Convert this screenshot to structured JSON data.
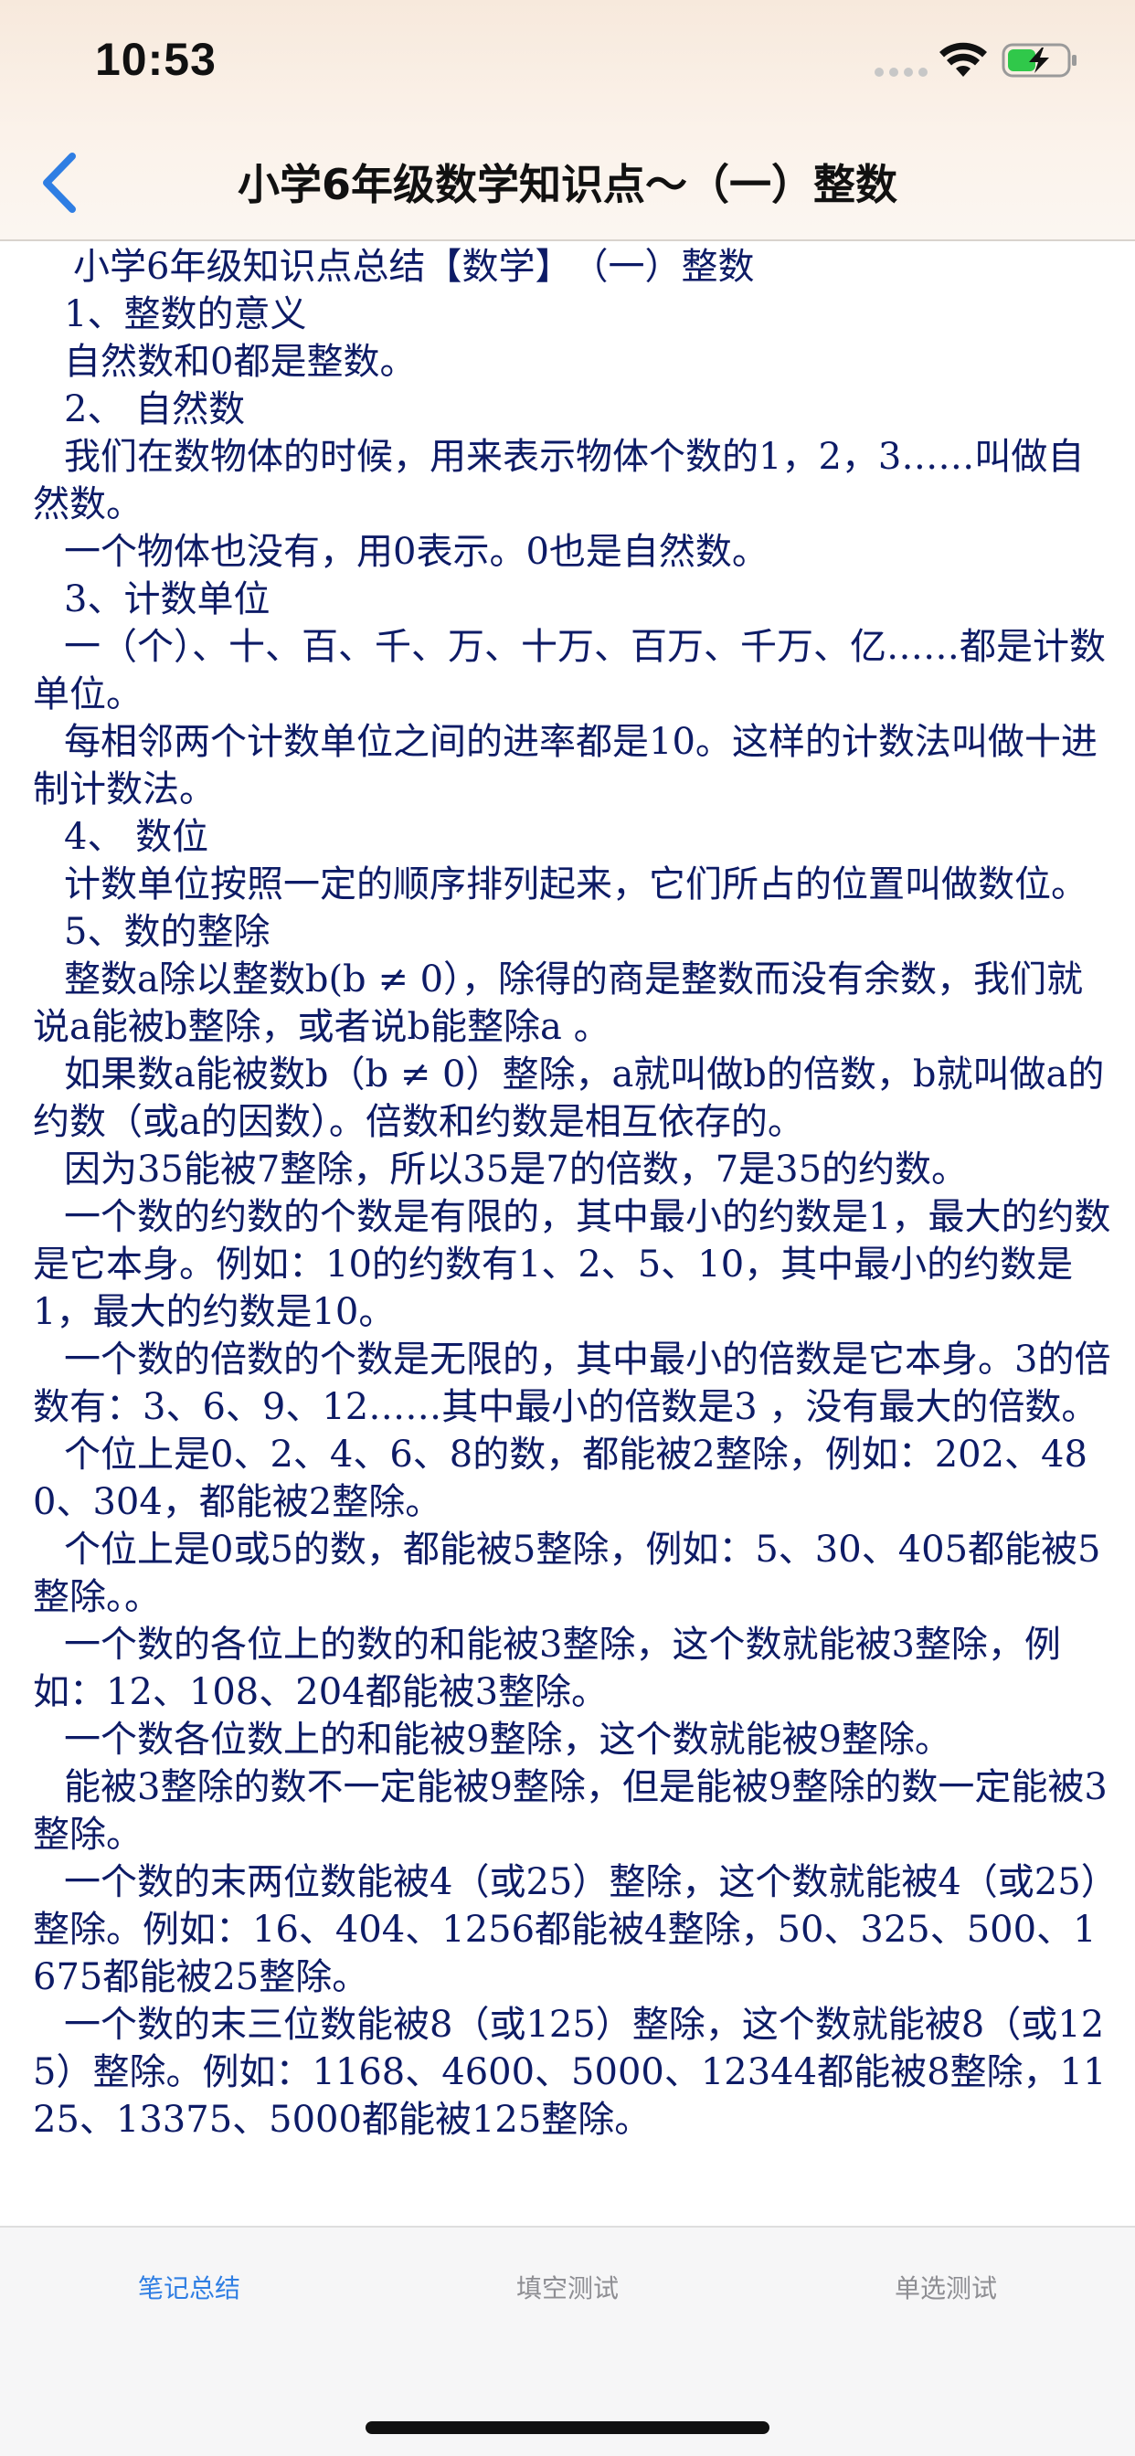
{
  "status_bar": {
    "time": "10:53",
    "icons": [
      "signal-icon",
      "wifi-icon",
      "battery-charging-icon"
    ],
    "battery_color": "#30c84a"
  },
  "nav": {
    "back_icon": "chevron-left-icon",
    "title": "小学6年级数学知识点～（一）整数",
    "accent_color": "#2f7ee3"
  },
  "article": {
    "paragraphs": [
      "小学6年级知识点总结【数学】　（一）整数",
      "1、整数的意义",
      "自然数和0都是整数。",
      "2、 自然数",
      "我们在数物体的时候，用来表示物体个数的1，2，3……叫做自然数。",
      "一个物体也没有，用0表示。0也是自然数。",
      "3、计数单位",
      "一（个）、十、百、千、万、十万、百万、千万、亿……都是计数单位。",
      "每相邻两个计数单位之间的进率都是10。这样的计数法叫做十进制计数法。",
      "4、 数位",
      "计数单位按照一定的顺序排列起来，它们所占的位置叫做数位。",
      "5、数的整除",
      "整数a除以整数b(b ≠ 0），除得的商是整数而没有余数，我们就说a能被b整除，或者说b能整除a 。",
      "如果数a能被数b（b ≠ 0）整除，a就叫做b的倍数，b就叫做a的约数（或a的因数）。倍数和约数是相互依存的。",
      "因为35能被7整除，所以35是7的倍数，7是35的约数。",
      "一个数的约数的个数是有限的，其中最小的约数是1，最大的约数是它本身。例如：10的约数有1、2、5、10，其中最小的约数是1，最大的约数是10。",
      "一个数的倍数的个数是无限的，其中最小的倍数是它本身。3的倍数有：3、6、9、12……其中最小的倍数是3 ，没有最大的倍数。",
      "个位上是0、2、4、6、8的数，都能被2整除，例如：202、480、304，都能被2整除。",
      "个位上是0或5的数，都能被5整除，例如：5、30、405都能被5整除。。",
      "一个数的各位上的数的和能被3整除，这个数就能被3整除，例如：12、108、204都能被3整除。",
      "一个数各位数上的和能被9整除，这个数就能被9整除。",
      "能被3整除的数不一定能被9整除，但是能被9整除的数一定能被3整除。",
      "一个数的末两位数能被4（或25）整除，这个数就能被4（或25）整除。例如：16、404、1256都能被4整除，50、325、500、1675都能被25整除。",
      "一个数的末三位数能被8（或125）整除，这个数就能被8（或125）整除。例如：1168、4600、5000、12344都能被8整除，1125、13375、5000都能被125整除。"
    ]
  },
  "tabs": [
    {
      "label": "笔记总结",
      "active": true
    },
    {
      "label": "填空测试",
      "active": false
    },
    {
      "label": "单选测试",
      "active": false
    }
  ]
}
